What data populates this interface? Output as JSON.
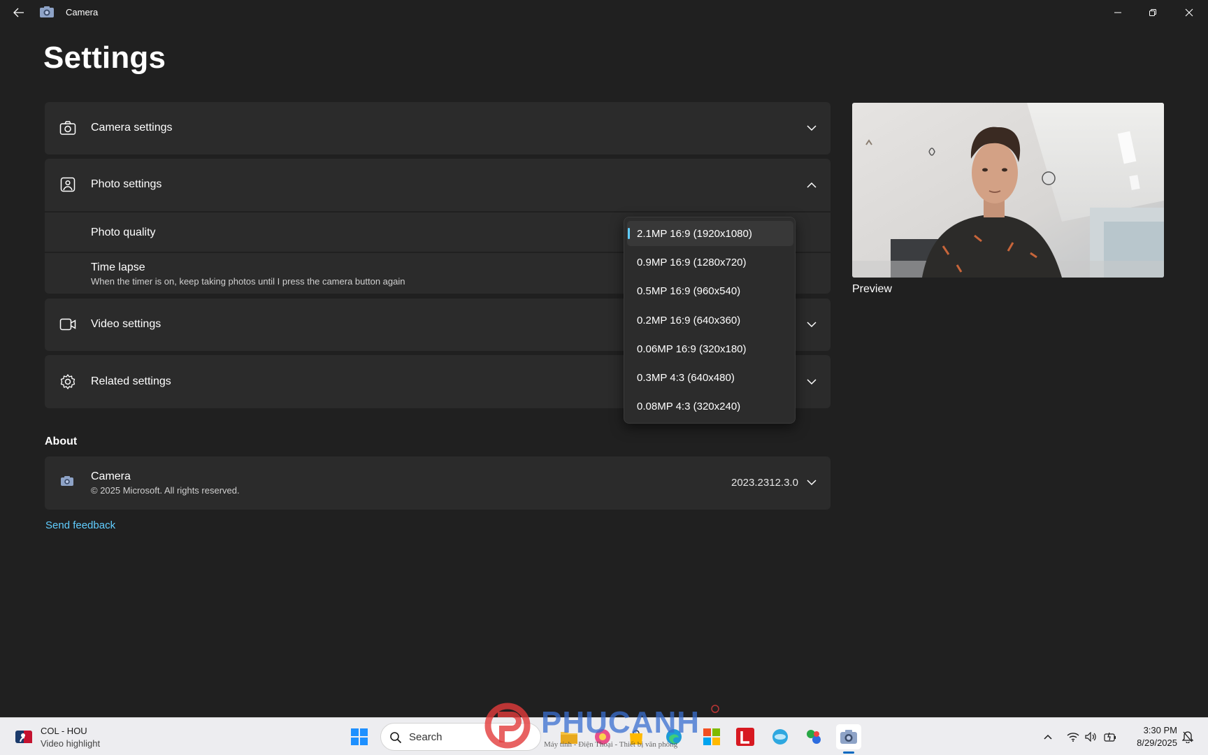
{
  "window": {
    "title": "Camera"
  },
  "page": {
    "title": "Settings"
  },
  "sections": {
    "camera_settings": {
      "label": "Camera settings",
      "icon": "camera-icon",
      "expanded": false
    },
    "photo_settings": {
      "label": "Photo settings",
      "icon": "image-icon",
      "expanded": true
    },
    "video_settings": {
      "label": "Video settings",
      "icon": "video-icon",
      "expanded": false
    },
    "related_settings": {
      "label": "Related settings",
      "icon": "gear-icon",
      "expanded": false
    }
  },
  "photo": {
    "quality_label": "Photo quality",
    "time_lapse_label": "Time lapse",
    "time_lapse_desc": "When the timer is on, keep taking photos until I press the camera button again"
  },
  "dropdown": {
    "options": [
      "2.1MP 16:9 (1920x1080)",
      "0.9MP 16:9 (1280x720)",
      "0.5MP 16:9 (960x540)",
      "0.2MP 16:9 (640x360)",
      "0.06MP 16:9 (320x180)",
      "0.3MP 4:3 (640x480)",
      "0.08MP 4:3 (320x240)"
    ],
    "selected_index": 0
  },
  "about": {
    "heading": "About",
    "app_name": "Camera",
    "copyright": "© 2025 Microsoft. All rights reserved.",
    "version": "2023.2312.3.0"
  },
  "links": {
    "feedback": "Send feedback"
  },
  "preview": {
    "label": "Preview"
  },
  "taskbar": {
    "widget_title": "COL - HOU",
    "widget_subtitle": "Video highlight",
    "search_placeholder": "Search",
    "time": "3:30 PM",
    "date": "8/29/2025",
    "apps": [
      "start-icon",
      "file-explorer-icon",
      "photos-icon",
      "edge-icon",
      "store-icon",
      "l-app-icon",
      "browser-icon",
      "network-app-icon",
      "camera-app-icon"
    ]
  },
  "watermark": {
    "brand": "PHUCANH",
    "tagline": "Máy tính - Điện Thoại - Thiết bị văn phòng"
  },
  "colors": {
    "background": "#202020",
    "card": "#2b2b2b",
    "accent": "#60cdff",
    "taskbar": "#ededf0"
  }
}
